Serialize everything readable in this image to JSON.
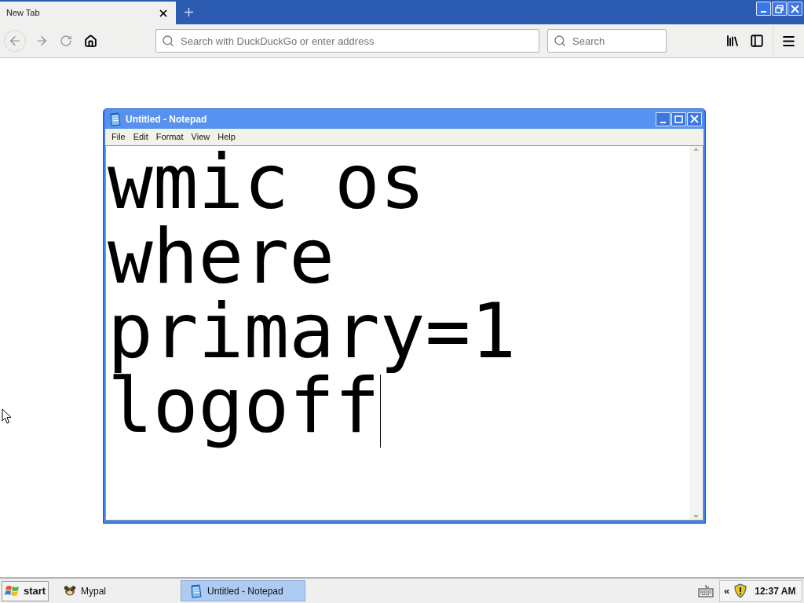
{
  "browser": {
    "tabs": [
      {
        "label": "New Tab",
        "selected": true
      }
    ],
    "address_bar": {
      "placeholder": "Search with DuckDuckGo or enter address"
    },
    "search_bar": {
      "placeholder": "Search"
    }
  },
  "notepad": {
    "title": "Untitled - Notepad",
    "menu": [
      "File",
      "Edit",
      "Format",
      "View",
      "Help"
    ],
    "lines": [
      "wmic os",
      "where",
      "primary=1",
      "logoff"
    ]
  },
  "taskbar": {
    "start": "start",
    "buttons": [
      {
        "label": "Mypal",
        "selected": false,
        "kind": "mypal"
      },
      {
        "label": "Untitled - Notepad",
        "selected": true,
        "kind": "notepad"
      }
    ],
    "tray": {
      "expand": "«",
      "clock": "12:37 AM"
    }
  }
}
